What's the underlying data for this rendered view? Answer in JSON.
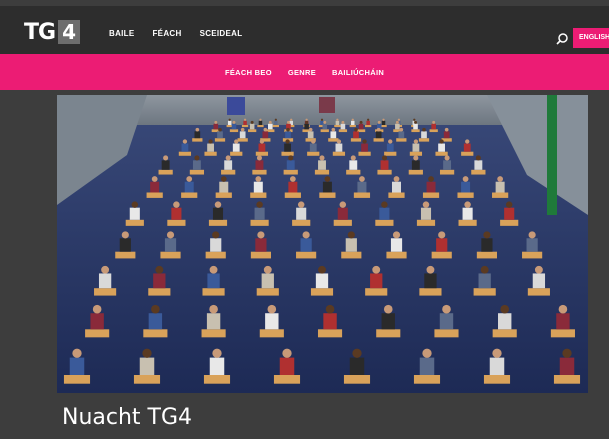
{
  "header": {
    "logo_text": "TG",
    "logo_num": "4",
    "nav": [
      "BAILE",
      "FÉACH",
      "SCEIDEAL"
    ],
    "language_button": "ENGLISH",
    "search_icon": "search-icon"
  },
  "subnav": [
    "FÉACH BEO",
    "GENRE",
    "BAILIÚCHÁIN"
  ],
  "hero": {
    "image": "exam-hall-photo"
  },
  "page": {
    "title": "Nuacht TG4"
  },
  "colors": {
    "accent": "#ec1c74",
    "topbar": "#2d2d2d",
    "background": "#3d3d3d"
  }
}
